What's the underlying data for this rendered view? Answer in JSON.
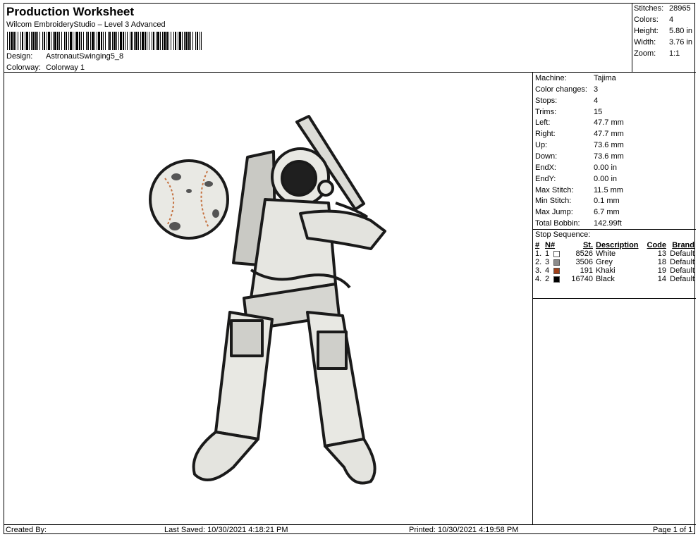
{
  "header": {
    "title": "Production Worksheet",
    "subtitle": "Wilcom EmbroideryStudio – Level 3 Advanced",
    "design_label": "Design:",
    "design_value": "AstronautSwinging5_8",
    "colorway_label": "Colorway:",
    "colorway_value": "Colorway 1"
  },
  "summary": [
    {
      "label": "Stitches:",
      "value": "28965"
    },
    {
      "label": "Colors:",
      "value": "4"
    },
    {
      "label": "Height:",
      "value": "5.80 in"
    },
    {
      "label": "Width:",
      "value": "3.76 in"
    },
    {
      "label": "Zoom:",
      "value": "1:1"
    }
  ],
  "details": [
    {
      "label": "Machine:",
      "value": "Tajima"
    },
    {
      "label": "Color changes:",
      "value": "3"
    },
    {
      "label": "Stops:",
      "value": "4"
    },
    {
      "label": "Trims:",
      "value": "15"
    },
    {
      "label": "Left:",
      "value": "47.7 mm"
    },
    {
      "label": "Right:",
      "value": "47.7 mm"
    },
    {
      "label": "Up:",
      "value": "73.6 mm"
    },
    {
      "label": "Down:",
      "value": "73.6 mm"
    },
    {
      "label": "EndX:",
      "value": "0.00 in"
    },
    {
      "label": "EndY:",
      "value": "0.00 in"
    },
    {
      "label": "Max Stitch:",
      "value": "11.5 mm"
    },
    {
      "label": "Min Stitch:",
      "value": "0.1 mm"
    },
    {
      "label": "Max Jump:",
      "value": "6.7 mm"
    },
    {
      "label": "Total Bobbin:",
      "value": "142.99ft"
    }
  ],
  "stop_sequence": {
    "title": "Stop Sequence:",
    "headers": [
      "#",
      "N#",
      "St.",
      "Description",
      "Code",
      "Brand"
    ],
    "rows": [
      {
        "idx": "1.",
        "n": "1",
        "color": "#ffffff",
        "st": "8526",
        "desc": "White",
        "code": "13",
        "brand": "Default"
      },
      {
        "idx": "2.",
        "n": "3",
        "color": "#8c8c8c",
        "st": "3506",
        "desc": "Grey",
        "code": "18",
        "brand": "Default"
      },
      {
        "idx": "3.",
        "n": "4",
        "color": "#a0401a",
        "st": "191",
        "desc": "Khaki",
        "code": "19",
        "brand": "Default"
      },
      {
        "idx": "4.",
        "n": "2",
        "color": "#000000",
        "st": "16740",
        "desc": "Black",
        "code": "14",
        "brand": "Default"
      }
    ]
  },
  "footer": {
    "created_by": "Created By:",
    "last_saved": "Last Saved: 10/30/2021 4:18:21 PM",
    "printed": "Printed: 10/30/2021 4:19:58 PM",
    "page": "Page 1 of 1"
  }
}
